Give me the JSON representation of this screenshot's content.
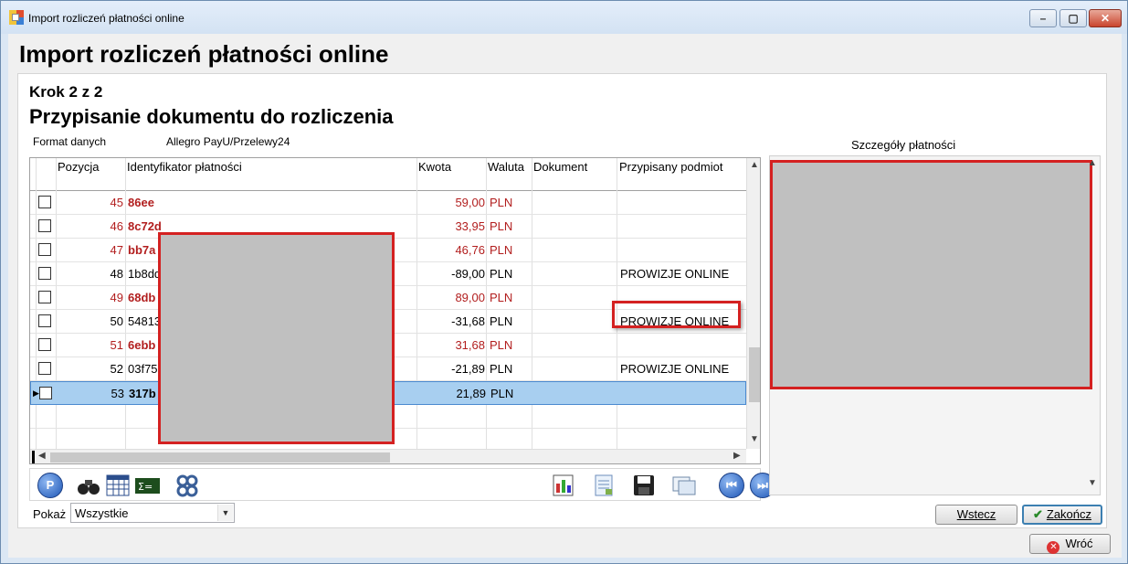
{
  "window": {
    "title": "Import rozliczeń płatności online",
    "min_glyph": "–",
    "max_glyph": "▢",
    "close_glyph": "✕"
  },
  "page": {
    "title": "Import rozliczeń płatności online",
    "step": "Krok 2 z 2",
    "subtitle": "Przypisanie dokumentu do rozliczenia",
    "format_label": "Format danych",
    "format_value": "Allegro PayU/Przelewy24",
    "details_label": "Szczegóły płatności"
  },
  "grid": {
    "columns": {
      "pos": "Pozycja",
      "id": "Identyfikator płatności",
      "kwota": "Kwota",
      "waluta": "Waluta",
      "dokument": "Dokument",
      "podmiot": "Przypisany podmiot"
    },
    "rows": [
      {
        "pos": "45",
        "id": "86ee",
        "kwota": "59,00",
        "waluta": "PLN",
        "dokument": "",
        "podmiot": ""
      },
      {
        "pos": "46",
        "id": "8c72d",
        "kwota": "33,95",
        "waluta": "PLN",
        "dokument": "",
        "podmiot": ""
      },
      {
        "pos": "47",
        "id": "bb7a",
        "kwota": "46,76",
        "waluta": "PLN",
        "dokument": "",
        "podmiot": ""
      },
      {
        "pos": "48",
        "id": "1b8dd",
        "kwota": "-89,00",
        "waluta": "PLN",
        "dokument": "",
        "podmiot": "PROWIZJE ONLINE"
      },
      {
        "pos": "49",
        "id": "68db",
        "kwota": "89,00",
        "waluta": "PLN",
        "dokument": "",
        "podmiot": ""
      },
      {
        "pos": "50",
        "id": "54813",
        "kwota": "-31,68",
        "waluta": "PLN",
        "dokument": "",
        "podmiot": "PROWIZJE ONLINE"
      },
      {
        "pos": "51",
        "id": "6ebb",
        "kwota": "31,68",
        "waluta": "PLN",
        "dokument": "",
        "podmiot": ""
      },
      {
        "pos": "52",
        "id": "03f753",
        "kwota": "-21,89",
        "waluta": "PLN",
        "dokument": "",
        "podmiot": "PROWIZJE ONLINE"
      },
      {
        "pos": "53",
        "id": "317b",
        "kwota": "21,89",
        "waluta": "PLN",
        "dokument": "",
        "podmiot": ""
      }
    ]
  },
  "filter": {
    "label": "Pokaż",
    "value": "Wszystkie"
  },
  "buttons": {
    "back": "Wstecz",
    "finish": "Zakończ",
    "exit": "Wróć"
  },
  "colors": {
    "highlight_red": "#d42121",
    "row_text_red": "#b21e1e",
    "selected_row": "#a8cff0"
  },
  "icons": {
    "toolbar": [
      "zoom-icon",
      "binoculars-icon",
      "calendar-grid-icon",
      "formula-icon",
      "link-icon",
      "report-icon",
      "document-icon",
      "save-icon",
      "windows-icon",
      "first-record-icon",
      "last-record-icon"
    ]
  }
}
